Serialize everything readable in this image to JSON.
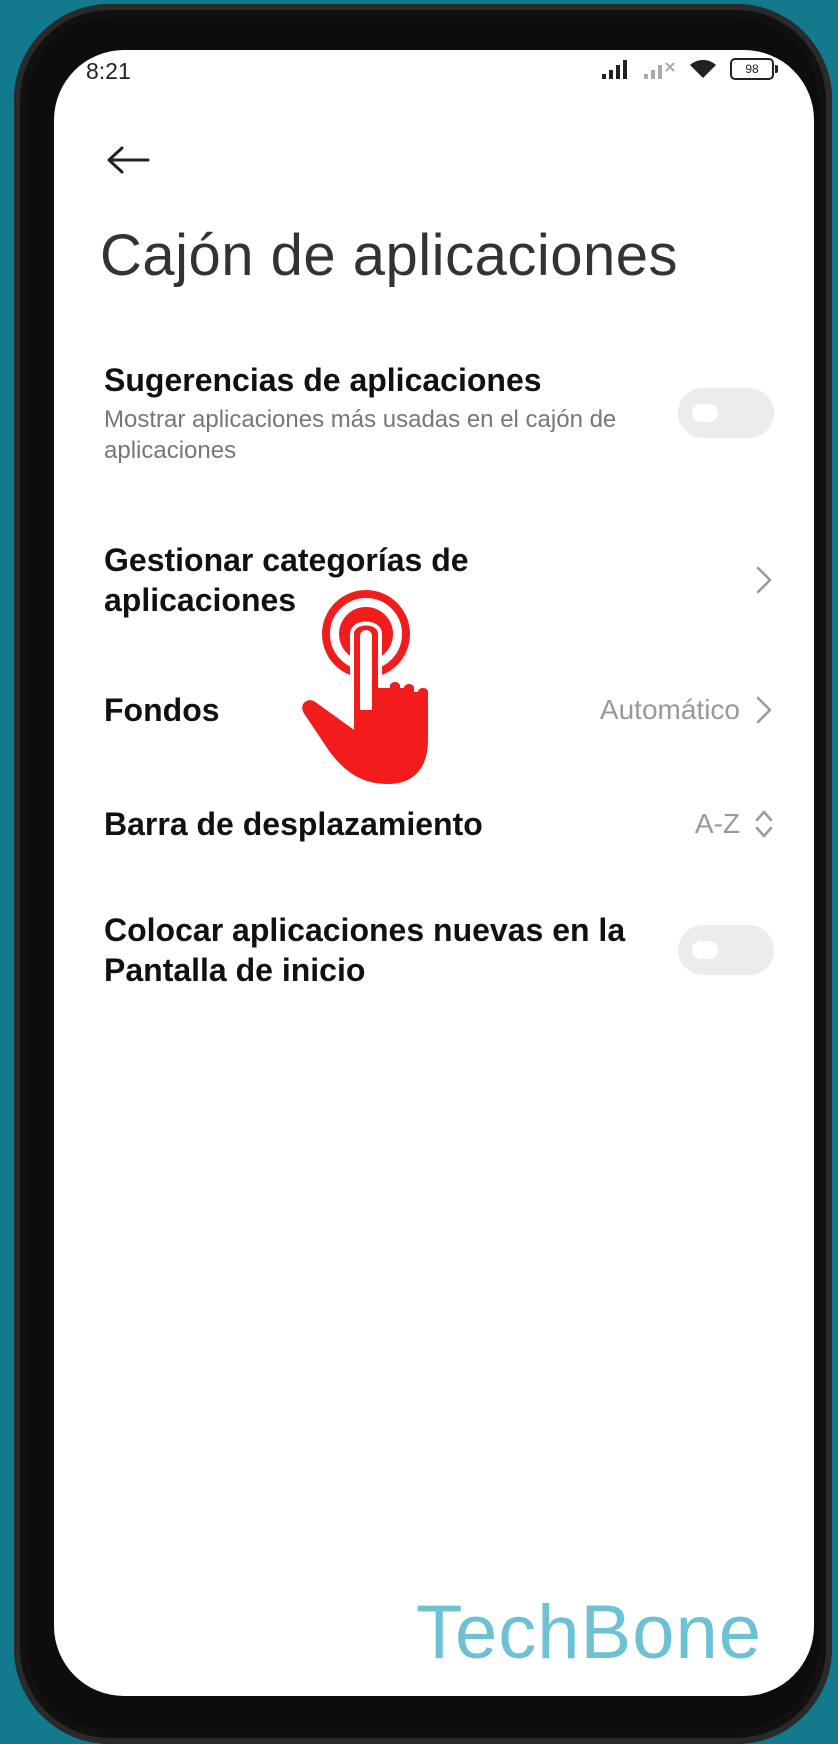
{
  "status_bar": {
    "time": "8:21",
    "battery": "98"
  },
  "header": {
    "title": "Cajón de aplicaciones"
  },
  "settings": {
    "app_suggestions": {
      "title": "Sugerencias de aplicaciones",
      "subtitle": "Mostrar aplicaciones más usadas en el cajón de aplicaciones",
      "enabled": false
    },
    "manage_categories": {
      "title": "Gestionar categorías de aplicaciones"
    },
    "backgrounds": {
      "title": "Fondos",
      "value": "Automático"
    },
    "scrollbar": {
      "title": "Barra de desplazamiento",
      "value": "A-Z"
    },
    "place_new_apps": {
      "title": "Colocar aplicaciones nuevas en la Pantalla de inicio",
      "enabled": false
    }
  },
  "watermark": "TechBone",
  "colors": {
    "background": "#127a8c",
    "tap_indicator": "#f21c1c",
    "watermark": "#6cc2d4"
  }
}
